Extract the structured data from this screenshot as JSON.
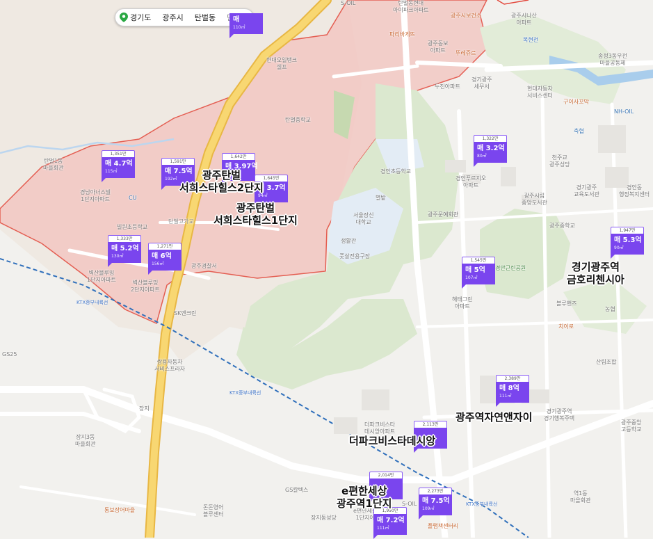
{
  "breadcrumb": {
    "region": "경기도",
    "city": "광주시",
    "dong": "탄벌동",
    "type": "단지"
  },
  "colors": {
    "accent": "#7a45ee",
    "zone": "#f3c8c3",
    "zone_border": "#e3463a",
    "park": "#dbe8cf",
    "road_main": "#f5c755",
    "railway": "#2f6fbb",
    "water": "#a9cdec"
  },
  "listings": [
    {
      "id": "m1",
      "count": "1,351만",
      "price": "매 4.7억",
      "area": "115㎡"
    },
    {
      "id": "m2",
      "count": "1,591만",
      "price": "매 7.5억",
      "area": "192㎡"
    },
    {
      "id": "m3",
      "count": "1,642만",
      "price": "매 3.97억",
      "area": ""
    },
    {
      "id": "m4",
      "count": "1,645만",
      "price": "매 3.7억",
      "area": "94㎡"
    },
    {
      "id": "m5",
      "count": "1,322만",
      "price": "매 3.2억",
      "area": "80㎡"
    },
    {
      "id": "m6",
      "count": "1,333만",
      "price": "매 5.2억",
      "area": "130㎡"
    },
    {
      "id": "m7",
      "count": "1,271만",
      "price": "매 6억",
      "area": "156㎡"
    },
    {
      "id": "m8",
      "count": "1,545만",
      "price": "매 5억",
      "area": "107㎡"
    },
    {
      "id": "m9",
      "count": "1,947만",
      "price": "매 5.3억",
      "area": "90㎡"
    },
    {
      "id": "m10",
      "count": "2,389만",
      "price": "매 8억",
      "area": "111㎡"
    },
    {
      "id": "m11",
      "count": "2,113만",
      "price": "",
      "area": ""
    },
    {
      "id": "m12",
      "count": "2,014만",
      "price": "",
      "area": ""
    },
    {
      "id": "m13",
      "count": "2,273만",
      "price": "매 7.5억",
      "area": "109㎡"
    },
    {
      "id": "m14",
      "count": "1,950만",
      "price": "매 7.2억",
      "area": "111㎡"
    },
    {
      "id": "m15",
      "count": "",
      "price": "매",
      "area": "110㎡"
    }
  ],
  "complexes": [
    {
      "id": "c1",
      "text": "광주탄벌\n서희스타힐스2단지"
    },
    {
      "id": "c2",
      "text": "광주탄벌\n서희스타힐스1단지"
    },
    {
      "id": "c3",
      "text": "경기광주역\n금호리첸시아"
    },
    {
      "id": "c4",
      "text": "광주역자연앤자이"
    },
    {
      "id": "c5",
      "text": "더파크비스타데시앙"
    },
    {
      "id": "c6",
      "text": "e편한세상\n광주역1단지"
    }
  ],
  "places": {
    "p1": "탄벌동현대\n아이파크아파트",
    "p2": "광주시보건소",
    "p3": "광주시나산\n아파트",
    "p4": "목현천",
    "p5": "송정3동우전\n마을공동체",
    "p6": "파리바게뜨",
    "p7": "광주동보\n아파트",
    "p8": "뚜레쥬르",
    "p9": "현대오일뱅크\n셀프",
    "p10": "경기광주\n세무서",
    "p11": "현대자동차\n서비스센터",
    "p12": "두진아파트",
    "p13": "구이사꼬막",
    "p14": "NH-OIL",
    "p15": "축협",
    "p16": "탄벌중학교",
    "p17": "탄벌1동\n마을회관",
    "p18": "경남아너스빌\n1단지아파트",
    "p19": "CU",
    "p20": "탄벌고가교",
    "p21": "빌원초등학교",
    "p22": "벽산블루밍\n1단지아파트",
    "p23": "벽산블루밍\n2단지아파트",
    "p24": "광주경찰서",
    "p25": "SK엔크린",
    "p26": "경안초등학교",
    "p27": "별밭",
    "p28": "서울장신\n대학교",
    "p29": "생활관",
    "p30": "풋살전용구장",
    "p31": "경안푸르지오\n아파트",
    "p32": "광주문예회관",
    "p33": "천주교\n광주성당",
    "p34": "광주시립\n중앙도서관",
    "p35": "광주중학교",
    "p36": "경기광주\n교육도서관",
    "p37": "경안동\n행정복지센터",
    "p38": "경안근린공원",
    "p39": "해태그린\n아파트",
    "p40": "블루핸즈",
    "p41": "치이로",
    "p42": "농협",
    "p43": "산림조합",
    "p44": "GS25",
    "p45": "쌍용자동차\n서비스프라자",
    "p46": "장지",
    "p47": "장지3동\n마을회관",
    "p48": "더파크비스타\n데시앙아파트",
    "p49": "경기광주역\n경기행복주택",
    "p50": "광주중앙\n고등학교",
    "p51": "GS칼텍스",
    "p52": "돈돈영어\n블루센터",
    "p53": "장지동성당",
    "p54": "통보장어마을",
    "p55": "e편한세상\n1단지아",
    "p56": "S-OIL",
    "p57": "플랩책센터리",
    "p58": "역1동\n마을회관",
    "p59": "S-OIL",
    "p60": "KTX중부내륙선",
    "p61": "KTX중부내륙선",
    "p62": "KTX중부내륙선"
  }
}
